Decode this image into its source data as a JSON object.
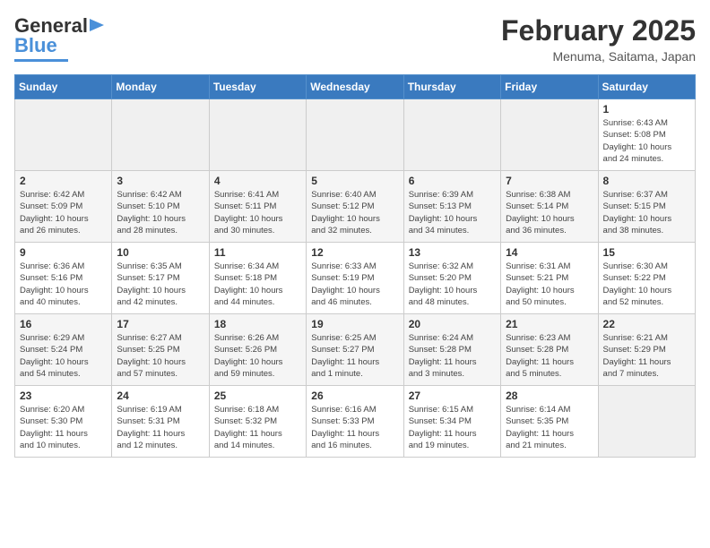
{
  "header": {
    "logo_general": "General",
    "logo_blue": "Blue",
    "month_title": "February 2025",
    "location": "Menuma, Saitama, Japan"
  },
  "weekdays": [
    "Sunday",
    "Monday",
    "Tuesday",
    "Wednesday",
    "Thursday",
    "Friday",
    "Saturday"
  ],
  "weeks": [
    [
      {
        "day": "",
        "info": ""
      },
      {
        "day": "",
        "info": ""
      },
      {
        "day": "",
        "info": ""
      },
      {
        "day": "",
        "info": ""
      },
      {
        "day": "",
        "info": ""
      },
      {
        "day": "",
        "info": ""
      },
      {
        "day": "1",
        "info": "Sunrise: 6:43 AM\nSunset: 5:08 PM\nDaylight: 10 hours\nand 24 minutes."
      }
    ],
    [
      {
        "day": "2",
        "info": "Sunrise: 6:42 AM\nSunset: 5:09 PM\nDaylight: 10 hours\nand 26 minutes."
      },
      {
        "day": "3",
        "info": "Sunrise: 6:42 AM\nSunset: 5:10 PM\nDaylight: 10 hours\nand 28 minutes."
      },
      {
        "day": "4",
        "info": "Sunrise: 6:41 AM\nSunset: 5:11 PM\nDaylight: 10 hours\nand 30 minutes."
      },
      {
        "day": "5",
        "info": "Sunrise: 6:40 AM\nSunset: 5:12 PM\nDaylight: 10 hours\nand 32 minutes."
      },
      {
        "day": "6",
        "info": "Sunrise: 6:39 AM\nSunset: 5:13 PM\nDaylight: 10 hours\nand 34 minutes."
      },
      {
        "day": "7",
        "info": "Sunrise: 6:38 AM\nSunset: 5:14 PM\nDaylight: 10 hours\nand 36 minutes."
      },
      {
        "day": "8",
        "info": "Sunrise: 6:37 AM\nSunset: 5:15 PM\nDaylight: 10 hours\nand 38 minutes."
      }
    ],
    [
      {
        "day": "9",
        "info": "Sunrise: 6:36 AM\nSunset: 5:16 PM\nDaylight: 10 hours\nand 40 minutes."
      },
      {
        "day": "10",
        "info": "Sunrise: 6:35 AM\nSunset: 5:17 PM\nDaylight: 10 hours\nand 42 minutes."
      },
      {
        "day": "11",
        "info": "Sunrise: 6:34 AM\nSunset: 5:18 PM\nDaylight: 10 hours\nand 44 minutes."
      },
      {
        "day": "12",
        "info": "Sunrise: 6:33 AM\nSunset: 5:19 PM\nDaylight: 10 hours\nand 46 minutes."
      },
      {
        "day": "13",
        "info": "Sunrise: 6:32 AM\nSunset: 5:20 PM\nDaylight: 10 hours\nand 48 minutes."
      },
      {
        "day": "14",
        "info": "Sunrise: 6:31 AM\nSunset: 5:21 PM\nDaylight: 10 hours\nand 50 minutes."
      },
      {
        "day": "15",
        "info": "Sunrise: 6:30 AM\nSunset: 5:22 PM\nDaylight: 10 hours\nand 52 minutes."
      }
    ],
    [
      {
        "day": "16",
        "info": "Sunrise: 6:29 AM\nSunset: 5:24 PM\nDaylight: 10 hours\nand 54 minutes."
      },
      {
        "day": "17",
        "info": "Sunrise: 6:27 AM\nSunset: 5:25 PM\nDaylight: 10 hours\nand 57 minutes."
      },
      {
        "day": "18",
        "info": "Sunrise: 6:26 AM\nSunset: 5:26 PM\nDaylight: 10 hours\nand 59 minutes."
      },
      {
        "day": "19",
        "info": "Sunrise: 6:25 AM\nSunset: 5:27 PM\nDaylight: 11 hours\nand 1 minute."
      },
      {
        "day": "20",
        "info": "Sunrise: 6:24 AM\nSunset: 5:28 PM\nDaylight: 11 hours\nand 3 minutes."
      },
      {
        "day": "21",
        "info": "Sunrise: 6:23 AM\nSunset: 5:28 PM\nDaylight: 11 hours\nand 5 minutes."
      },
      {
        "day": "22",
        "info": "Sunrise: 6:21 AM\nSunset: 5:29 PM\nDaylight: 11 hours\nand 7 minutes."
      }
    ],
    [
      {
        "day": "23",
        "info": "Sunrise: 6:20 AM\nSunset: 5:30 PM\nDaylight: 11 hours\nand 10 minutes."
      },
      {
        "day": "24",
        "info": "Sunrise: 6:19 AM\nSunset: 5:31 PM\nDaylight: 11 hours\nand 12 minutes."
      },
      {
        "day": "25",
        "info": "Sunrise: 6:18 AM\nSunset: 5:32 PM\nDaylight: 11 hours\nand 14 minutes."
      },
      {
        "day": "26",
        "info": "Sunrise: 6:16 AM\nSunset: 5:33 PM\nDaylight: 11 hours\nand 16 minutes."
      },
      {
        "day": "27",
        "info": "Sunrise: 6:15 AM\nSunset: 5:34 PM\nDaylight: 11 hours\nand 19 minutes."
      },
      {
        "day": "28",
        "info": "Sunrise: 6:14 AM\nSunset: 5:35 PM\nDaylight: 11 hours\nand 21 minutes."
      },
      {
        "day": "",
        "info": ""
      }
    ]
  ]
}
